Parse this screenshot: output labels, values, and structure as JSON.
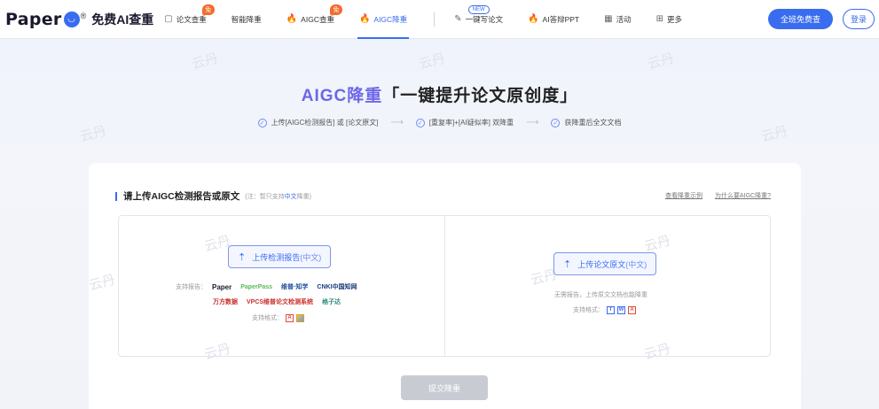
{
  "header": {
    "logo_word": "Paper",
    "logo_reg": "®",
    "logo_sub": "免费AI查重",
    "nav": [
      {
        "label": "论文查重",
        "icon": "document-check-icon",
        "badge": "免"
      },
      {
        "label": "智能降重",
        "icon": "",
        "badge": ""
      },
      {
        "label": "AIGC查重",
        "icon": "fire-icon",
        "badge": "免"
      },
      {
        "label": "AIGC降重",
        "icon": "fire-icon",
        "badge": "",
        "active": true
      },
      {
        "label": "一键写论文",
        "icon": "pen-icon",
        "badge": "NEW"
      },
      {
        "label": "AI答辩PPT",
        "icon": "fire-icon",
        "badge": ""
      },
      {
        "label": "活动",
        "icon": "calendar-icon",
        "badge": ""
      },
      {
        "label": "更多",
        "icon": "grid-icon",
        "badge": ""
      }
    ],
    "primary_button": "全班免费查",
    "login_button": "登录"
  },
  "hero": {
    "title_accent": "AIGC降重",
    "title_rest": "「一键提升论文原创度」",
    "steps": [
      "上传[AIGC检测报告] 或 [论文原文]",
      "[重复率]+[AI疑似率] 双降重",
      "获降重后全文文档"
    ]
  },
  "card": {
    "title": "请上传AIGC检测报告或原文",
    "note_prefix": "(注：暂只支持",
    "note_highlight": "中文",
    "note_suffix": "降重)",
    "link_example": "查看降重示例",
    "link_why": "为什么要AIGC降重?",
    "left": {
      "button_label": "上传检测报告",
      "button_suffix": "(中文)",
      "support_label": "支持报告：",
      "brands_row1": [
        "Paper",
        "PaperPass",
        "维普·知学",
        "CNKI中国知网"
      ],
      "brands_row2": [
        "万方数据",
        "VPCS维普论文检测系统",
        "格子达"
      ],
      "formats_label": "支持格式："
    },
    "right": {
      "button_label": "上传论文原文",
      "button_suffix": "(中文)",
      "hint": "无需报告，上传原文文档也能降重",
      "formats_label": "支持格式："
    },
    "submit": "提交降重"
  },
  "watermark": "云丹",
  "colors": {
    "accent": "#3a6cf0",
    "title_accent": "#6d67e8",
    "fire": "#e8402b"
  }
}
